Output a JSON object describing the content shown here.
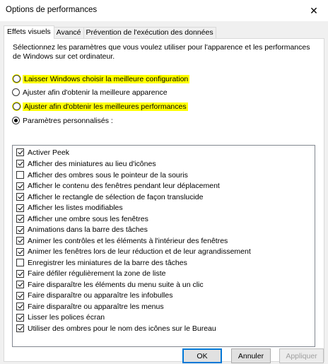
{
  "window": {
    "title": "Options de performances",
    "close_glyph": "✕"
  },
  "tabs": [
    {
      "label": "Effets visuels",
      "active": true
    },
    {
      "label": "Avancé",
      "active": false
    },
    {
      "label": "Prévention de l'exécution des données",
      "active": false
    }
  ],
  "intro": "Sélectionnez les paramètres que vous voulez utiliser pour l'apparence et les performances de Windows sur cet ordinateur.",
  "radios": [
    {
      "label": "Laisser Windows choisir la meilleure configuration",
      "selected": false,
      "highlighted": true
    },
    {
      "label": "Ajuster afin d'obtenir la meilleure apparence",
      "selected": false,
      "highlighted": false
    },
    {
      "label": "Ajuster afin d'obtenir les meilleures performances",
      "selected": false,
      "highlighted": true
    },
    {
      "label": "Paramètres personnalisés :",
      "selected": true,
      "highlighted": false
    }
  ],
  "checklist": [
    {
      "label": "Activer Peek",
      "checked": true
    },
    {
      "label": "Afficher des miniatures au lieu d'icônes",
      "checked": true
    },
    {
      "label": "Afficher des ombres sous le pointeur de la souris",
      "checked": false
    },
    {
      "label": "Afficher le contenu des fenêtres pendant leur déplacement",
      "checked": true
    },
    {
      "label": "Afficher le rectangle de sélection de façon translucide",
      "checked": true
    },
    {
      "label": "Afficher les listes modifiables",
      "checked": true
    },
    {
      "label": "Afficher une ombre sous les fenêtres",
      "checked": true
    },
    {
      "label": "Animations dans la barre des tâches",
      "checked": true
    },
    {
      "label": "Animer les contrôles et les éléments à l'intérieur des fenêtres",
      "checked": true
    },
    {
      "label": "Animer les fenêtres lors de leur réduction et de leur agrandissement",
      "checked": true
    },
    {
      "label": "Enregistrer les miniatures de la barre des tâches",
      "checked": false
    },
    {
      "label": "Faire défiler régulièrement la zone de liste",
      "checked": true
    },
    {
      "label": "Faire disparaître les éléments du menu suite à un clic",
      "checked": true
    },
    {
      "label": "Faire disparaître ou apparaître les infobulles",
      "checked": true
    },
    {
      "label": "Faire disparaître ou apparaître les menus",
      "checked": true
    },
    {
      "label": "Lisser les polices écran",
      "checked": true
    },
    {
      "label": "Utiliser des ombres pour le nom des icônes sur le Bureau",
      "checked": true
    }
  ],
  "buttons": {
    "ok": "OK",
    "cancel": "Annuler",
    "apply": "Appliquer"
  },
  "colors": {
    "highlight": "#ffff00",
    "default_button_border": "#0078d7"
  }
}
